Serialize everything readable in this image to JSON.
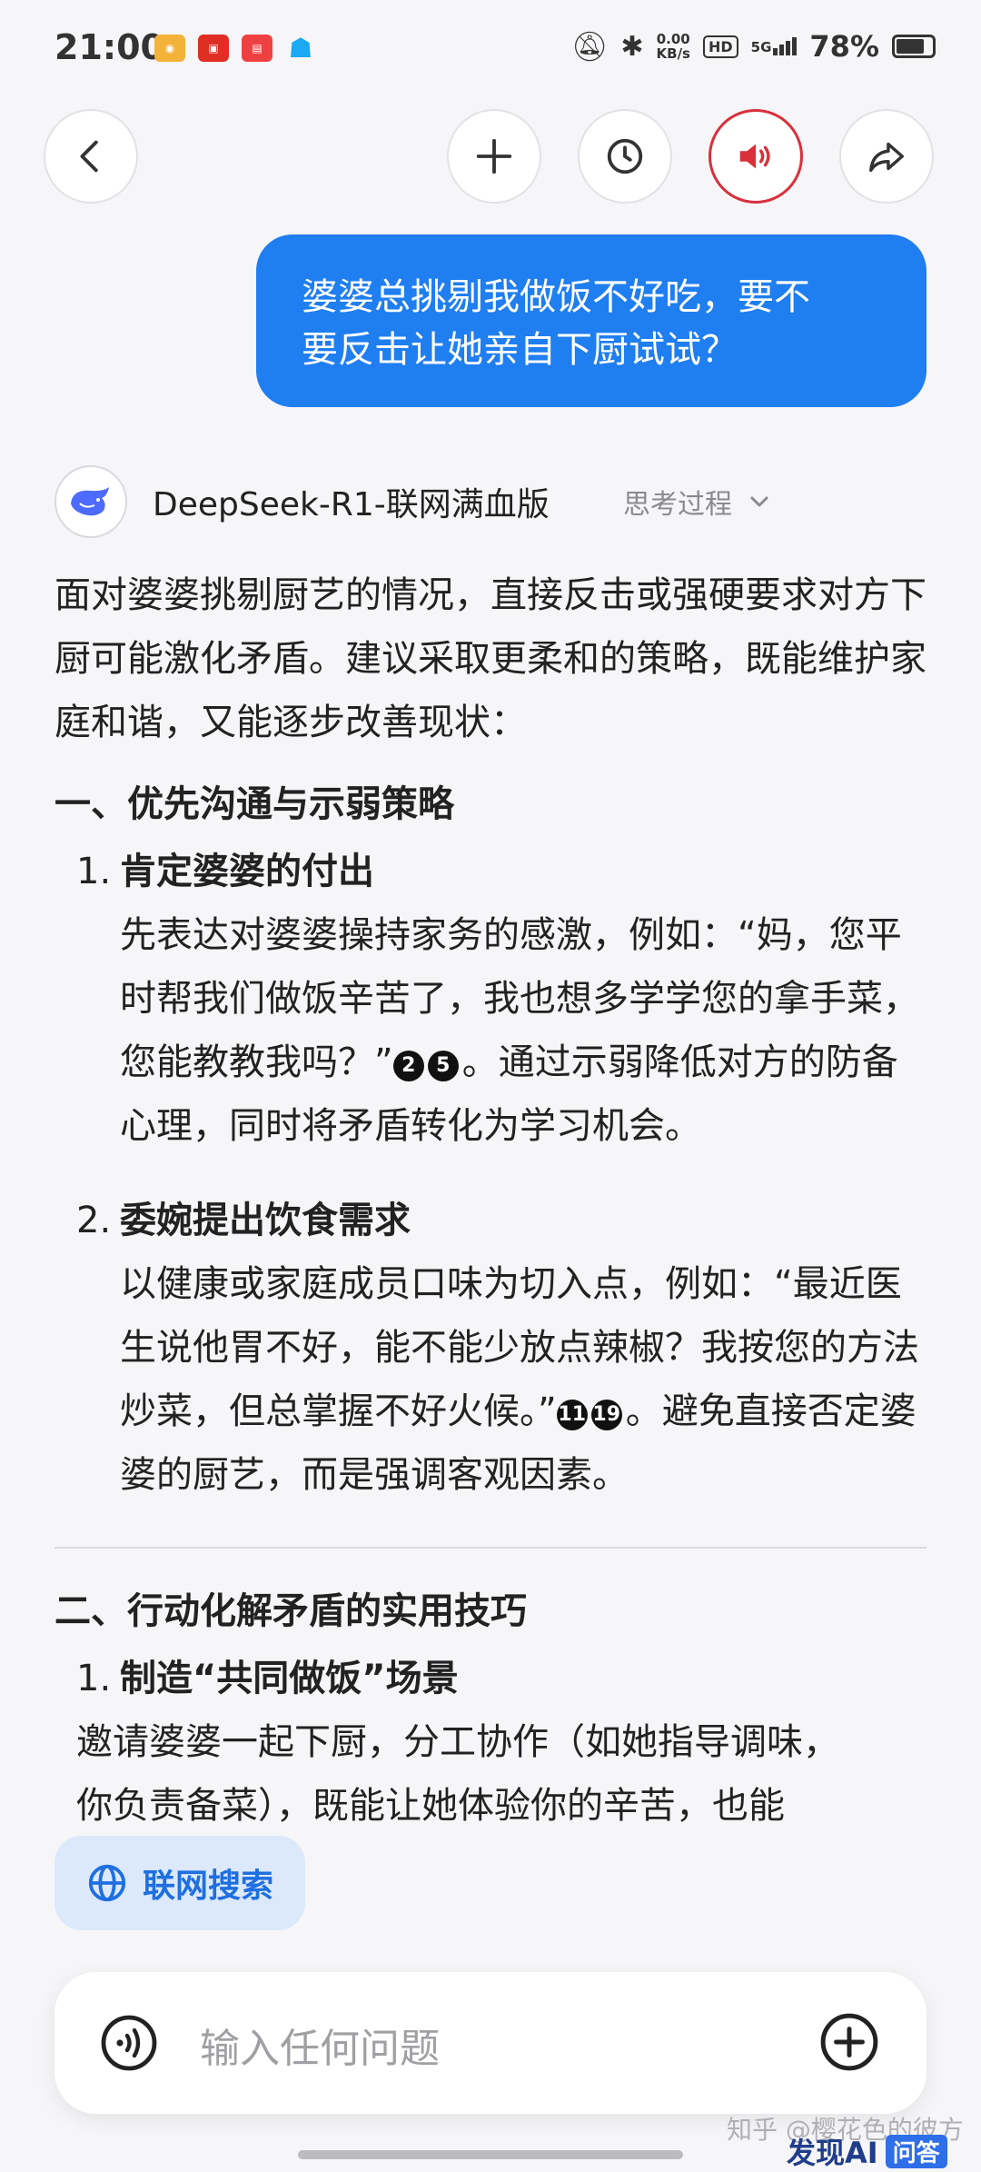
{
  "status_bar": {
    "time": "21:00",
    "app_icons": [
      "weibo-icon",
      "pinduoduo-icon",
      "toutiao-icon",
      "qq-icon"
    ],
    "net_speed_value": "0.00",
    "net_speed_unit": "KB/s",
    "hd_label": "HD",
    "network": "5G",
    "battery": "78%",
    "battery_level": 0.78
  },
  "top_bar": {
    "back": "chevron-left-icon",
    "new_chat": "plus-icon",
    "history": "clock-icon",
    "speaker": "speaker-icon",
    "share": "share-icon",
    "speaker_color": "#d9303b"
  },
  "user_message": {
    "line1": "婆婆总挑剔我做饭不好吃，要不",
    "line2": "要反击让她亲自下厨试试？"
  },
  "assistant": {
    "model_name": "DeepSeek-R1-联网满血版",
    "think_label": "思考过程",
    "intro": "面对婆婆挑剔厨艺的情况，直接反击或强硬要求对方下厨可能激化矛盾。建议采取更柔和的策略，既能维护家庭和谐，又能逐步改善现状：",
    "section1_title": "一、优先沟通与示弱策略",
    "item1": {
      "num": "1.",
      "title": "肯定婆婆的付出",
      "body_a": "先表达对婆婆操持家务的感激，例如：“妈，您平时帮我们做饭辛苦了，我也想多学学您的拿手菜，您能教教我吗？”",
      "cite_a": "2",
      "cite_b": "5",
      "body_b": "。通过示弱降低对方的防备心理，同时将矛盾转化为学习机会。"
    },
    "item2": {
      "num": "2.",
      "title": "委婉提出饮食需求",
      "body_a": "以健康或家庭成员口味为切入点，例如：“最近医生说他胃不好，能不能少放点辣椒？我按您的方法炒菜，但总掌握不好火候。”",
      "cite_a": "11",
      "cite_b": "19",
      "body_b": "。避免直接否定婆婆的厨艺，而是强调客观因素。"
    },
    "section2_title": "二、行动化解矛盾的实用技巧",
    "item3": {
      "num": "1.",
      "title": "制造“共同做饭”场景",
      "line1": "邀请婆婆一起下厨，分工协作（如她指导调味，",
      "line2": "你负责备菜），既能让她体验你的辛苦，也能"
    }
  },
  "web_search_label": "联网搜索",
  "input": {
    "placeholder": "输入任何问题"
  },
  "watermark": "知乎 @樱花色的彼方",
  "brand": {
    "name": "发现AI",
    "tag": "问答"
  }
}
